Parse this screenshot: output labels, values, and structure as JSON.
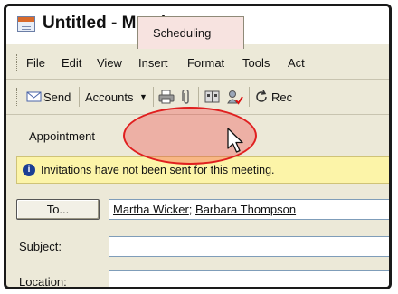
{
  "window": {
    "title": "Untitled - Meeting"
  },
  "menu": {
    "items": [
      "File",
      "Edit",
      "View",
      "Insert",
      "Format",
      "Tools",
      "Act"
    ]
  },
  "toolbar": {
    "send_label": "Send",
    "accounts_label": "Accounts",
    "reply_label": "Rec"
  },
  "tabs": {
    "appointment": "Appointment",
    "scheduling": "Scheduling"
  },
  "infobar": {
    "message": "Invitations have not been sent for this meeting."
  },
  "form": {
    "to_button": "To...",
    "to_recipients": [
      "Martha Wicker",
      "Barbara Thompson"
    ],
    "to_separator": "; ",
    "subject_label": "Subject:",
    "subject_value": "",
    "location_label": "Location:"
  },
  "colors": {
    "highlight": "#e01f1f",
    "infobar_bg": "#fcf4a8",
    "chrome": "#ece9d8"
  }
}
